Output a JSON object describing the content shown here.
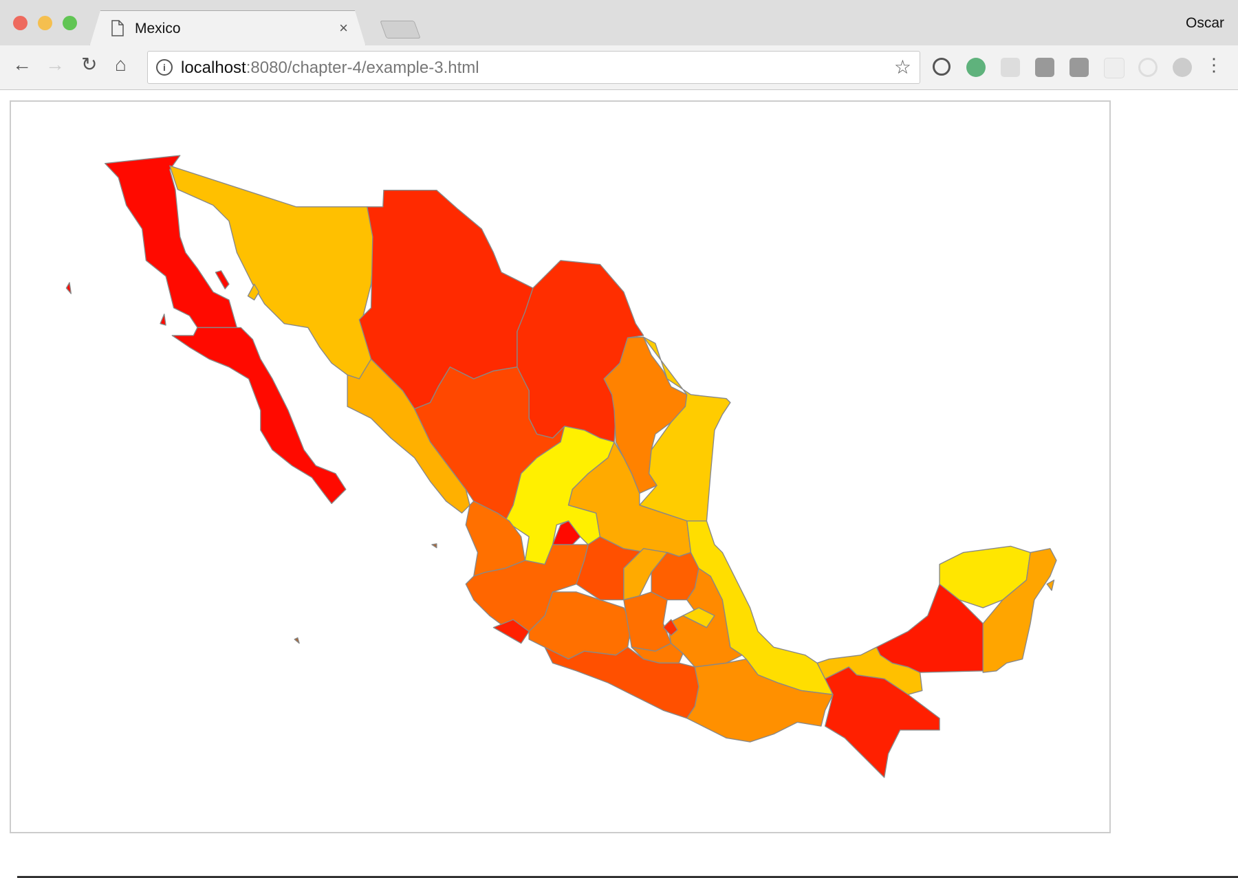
{
  "browser": {
    "tab_title": "Mexico",
    "tab_close": "×",
    "profile_name": "Oscar",
    "url_host": "localhost",
    "url_rest": ":8080/chapter-4/example-3.html",
    "nav": {
      "back": "←",
      "forward": "→",
      "reload": "↻",
      "home": "⌂",
      "star": "☆",
      "menu": "⋮",
      "info": "i"
    }
  },
  "colors": {
    "red": "#ff0a00",
    "orange_red": "#ff2a00",
    "dark_orange": "#ff4c00",
    "orange": "#ff6e00",
    "light_orange": "#ff9000",
    "amber": "#ffb000",
    "gold": "#ffc400",
    "yellow": "#ffe000",
    "bright_yellow": "#fff000"
  }
}
